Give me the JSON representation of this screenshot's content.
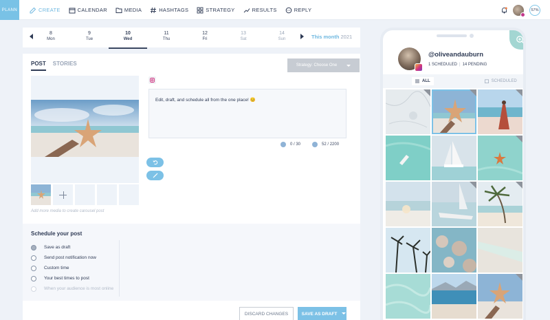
{
  "logo": "PLANN",
  "nav": [
    {
      "label": "CREATE",
      "icon": "edit-icon",
      "active": true
    },
    {
      "label": "CALENDAR",
      "icon": "calendar-icon"
    },
    {
      "label": "MEDIA",
      "icon": "folder-icon"
    },
    {
      "label": "HASHTAGS",
      "icon": "hashtag-icon"
    },
    {
      "label": "STRATEGY",
      "icon": "grid-icon"
    },
    {
      "label": "RESULTS",
      "icon": "trend-icon"
    },
    {
      "label": "REPLY",
      "icon": "chat-icon"
    }
  ],
  "topright": {
    "progress": "57%"
  },
  "dates": [
    {
      "num": "8",
      "name": "Mon"
    },
    {
      "num": "9",
      "name": "Tue"
    },
    {
      "num": "10",
      "name": "Wed",
      "active": true
    },
    {
      "num": "11",
      "name": "Thu"
    },
    {
      "num": "12",
      "name": "Fri"
    },
    {
      "num": "13",
      "name": "Sat",
      "muted": true
    },
    {
      "num": "14",
      "name": "Sun",
      "muted": true
    }
  ],
  "month": {
    "label": "This month",
    "year": "2021"
  },
  "composer": {
    "tabs": [
      "POST",
      "STORIES"
    ],
    "strategy_label": "Strategy: Choose One",
    "caption": "Edit, draft, and schedule all from the one place! 😊",
    "hashtag_count": "0 / 30",
    "char_count": "52 / 2200",
    "media_hint": "Add more media to create carousel post"
  },
  "schedule": {
    "title": "Schedule your post",
    "options": [
      {
        "label": "Save as draft",
        "selected": true
      },
      {
        "label": "Send post notification now"
      },
      {
        "label": "Custom time"
      },
      {
        "label": "Your best times to post"
      },
      {
        "label": "When your audience is most online",
        "disabled": true
      }
    ]
  },
  "actions": {
    "discard": "DISCARD CHANGES",
    "save": "SAVE AS DRAFT"
  },
  "profile": {
    "username": "@oliveandauburn",
    "scheduled": "1 SCHEDULED",
    "pending": "14 PENDING",
    "filter_all": "ALL",
    "filter_scheduled": "SCHEDULED"
  },
  "grid": [
    {
      "theme": "marble-white",
      "corner": true
    },
    {
      "theme": "starfish-hand",
      "selected": true,
      "corner": true
    },
    {
      "theme": "beach-dress",
      "corner": true
    },
    {
      "theme": "boat-turquoise"
    },
    {
      "theme": "sailboat-white"
    },
    {
      "theme": "starfish-water",
      "corner": true
    },
    {
      "theme": "beach-glass"
    },
    {
      "theme": "sailboats-sea",
      "corner": true
    },
    {
      "theme": "palm-beach",
      "corner": true
    },
    {
      "theme": "palms-sky"
    },
    {
      "theme": "rocks-water"
    },
    {
      "theme": "sand-texture"
    },
    {
      "theme": "turquoise-shallow"
    },
    {
      "theme": "bay-mountains"
    },
    {
      "theme": "starfish-sky"
    }
  ],
  "colors": {
    "accent": "#7cc1e6",
    "text": "#2f3b55",
    "muted": "#9aa6b8",
    "instagram": "#d0327f"
  }
}
